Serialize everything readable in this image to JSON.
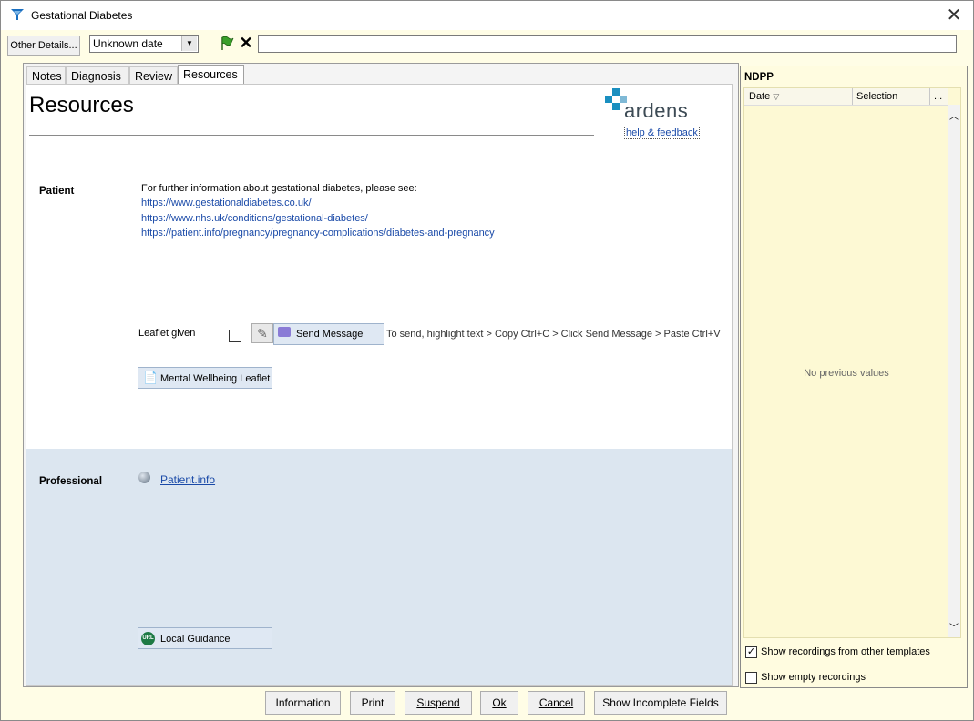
{
  "window": {
    "title": "Gestational Diabetes"
  },
  "toolbar": {
    "other_details_label": "Other Details...",
    "date_value": "Unknown date"
  },
  "tabs": [
    "Notes",
    "Diagnosis",
    "Review",
    "Resources"
  ],
  "page": {
    "title": "Resources",
    "logo_text": "ardens",
    "help_link": "help & feedback"
  },
  "patient": {
    "label": "Patient",
    "info_text": "For further information about gestational diabetes, please see:",
    "links": [
      "https://www.gestationaldiabetes.co.uk/",
      "https://www.nhs.uk/conditions/gestational-diabetes/",
      "https://patient.info/pregnancy/pregnancy-complications/diabetes-and-pregnancy"
    ],
    "leaflet_label": "Leaflet given",
    "send_message_label": "Send Message",
    "hint": "To send, highlight text > Copy Ctrl+C > Click Send Message > Paste Ctrl+V",
    "mental_wellbeing_label": "Mental Wellbeing Leaflet"
  },
  "professional": {
    "label": "Professional",
    "patient_info_link": "Patient.info",
    "local_guidance_label": "Local Guidance",
    "local_guidance_icon_text": "URL"
  },
  "side_panel": {
    "title": "NDPP",
    "columns": [
      "Date",
      "Selection",
      "..."
    ],
    "empty_text": "No previous values",
    "show_other_templates": "Show recordings from other templates",
    "show_other_templates_checked": true,
    "show_empty": "Show empty recordings",
    "show_empty_checked": false
  },
  "footer": {
    "information": "Information",
    "print": "Print",
    "suspend": "Suspend",
    "ok": "Ok",
    "cancel": "Cancel",
    "show_incomplete": "Show Incomplete Fields"
  },
  "colors": {
    "link": "#1a4aa8",
    "professional_bg": "#dce6f0",
    "side_bg": "#fffce0",
    "logo_cross": "#1a8fc0"
  }
}
